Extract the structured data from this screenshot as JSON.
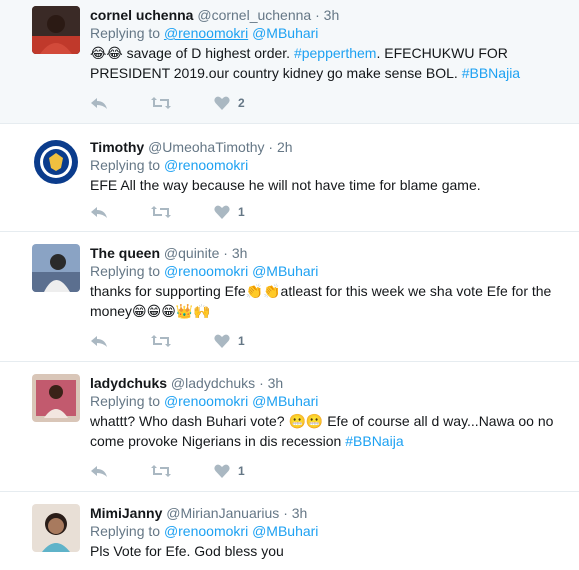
{
  "tweets": [
    {
      "fullname": "cornel uchenna",
      "username": "@cornel_uchenna",
      "separator": "·",
      "time": "3h",
      "replying_label": "Replying to",
      "mentions": [
        "@renoomokri",
        "@MBuhari"
      ],
      "text_emoji": "😂😂",
      "text_main": " savage of D highest order. ",
      "hashtag1": "#pepperthem",
      "text_main2": ". EFECHUKWU FOR PRESIDENT 2019.our country kidney go make sense BOL. ",
      "hashtag2": "#BBNajia",
      "likes": "2"
    },
    {
      "fullname": "Timothy",
      "username": "@UmeohaTimothy",
      "separator": "·",
      "time": "2h",
      "replying_label": "Replying to",
      "mentions": [
        "@renoomokri"
      ],
      "text": "EFE All the way because he will not have time for blame game.",
      "likes": "1"
    },
    {
      "fullname": "The queen",
      "username": "@quinite",
      "separator": "·",
      "time": "3h",
      "replying_label": "Replying to",
      "mentions": [
        "@renoomokri",
        "@MBuhari"
      ],
      "text_a": "thanks for supporting Efe",
      "emoji_a": "👏👏",
      "text_b": "atleast for this week we sha vote Efe for the money",
      "emoji_b": "😁😁😁👑🙌",
      "likes": "1"
    },
    {
      "fullname": "ladydchuks",
      "username": "@ladydchuks",
      "separator": "·",
      "time": "3h",
      "replying_label": "Replying to",
      "mentions": [
        "@renoomokri",
        "@MBuhari"
      ],
      "text_a": "whattt? Who dash Buhari vote? ",
      "emoji_a": "😬😬",
      "text_b": " Efe of course all d way...Nawa oo no come provoke Nigerians in dis recession ",
      "hashtag": "#BBNaija",
      "likes": "1"
    },
    {
      "fullname": "MimiJanny",
      "username": "@MirianJanuarius",
      "separator": "·",
      "time": "3h",
      "replying_label": "Replying to",
      "mentions": [
        "@renoomokri",
        "@MBuhari"
      ],
      "text": "Pls Vote for Efe. God bless you"
    }
  ],
  "colors": {
    "link": "#1da1f2",
    "muted": "#657786",
    "icon": "#aab8c2",
    "highlight_bg": "#f5f8fa"
  },
  "icons": [
    "reply-icon",
    "retweet-icon",
    "like-icon"
  ]
}
